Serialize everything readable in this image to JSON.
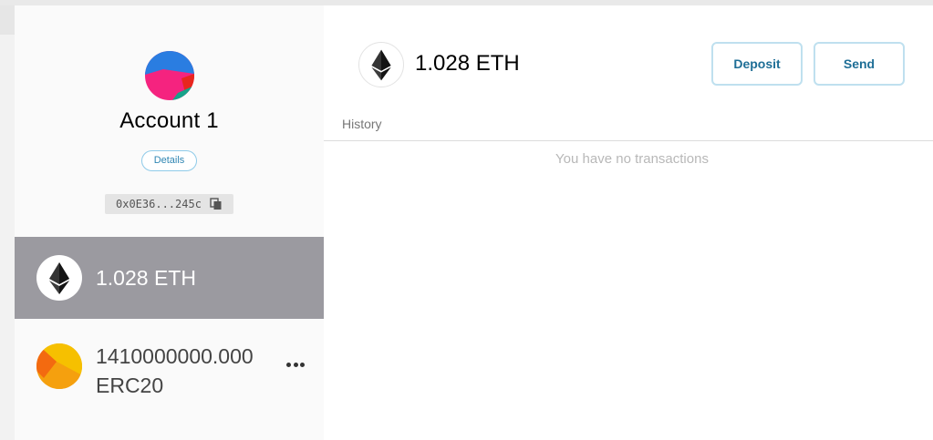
{
  "account": {
    "name": "Account 1",
    "details_label": "Details",
    "address_short": "0x0E36...245c"
  },
  "tokens": [
    {
      "amount": "1.028 ETH",
      "icon": "eth-logo-icon",
      "selected": true
    },
    {
      "amount_line1": "1410000000.000",
      "amount_line2": "ERC20",
      "icon": "erc20-token-icon",
      "selected": false
    }
  ],
  "main": {
    "balance": "1.028 ETH",
    "deposit_label": "Deposit",
    "send_label": "Send",
    "history_label": "History",
    "empty_message": "You have no transactions"
  },
  "colors": {
    "selected_row": "#9b9aa0",
    "button_text": "#1e6e96",
    "button_border": "#bfe0ef"
  }
}
